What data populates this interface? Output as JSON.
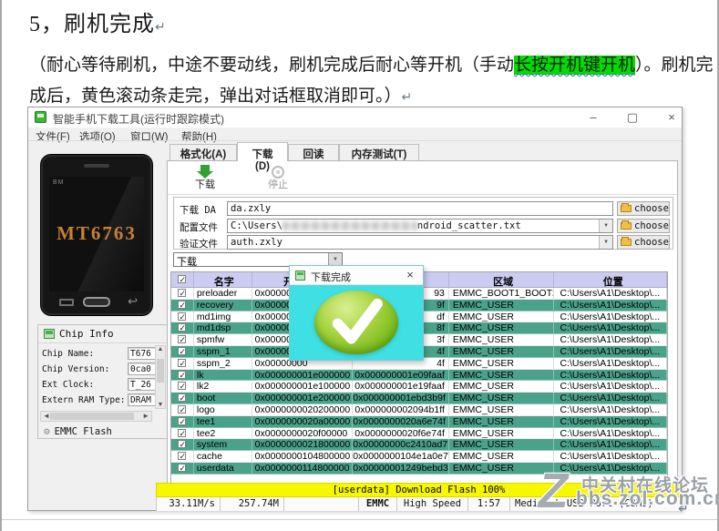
{
  "document": {
    "heading": "5，刷机完成",
    "line1_pre": "（耐心等待刷机，中途不要动线，刷机完成后耐心等开机（手动",
    "line1_highlight": "长按开机键开机",
    "line1_post": "）。刷机完",
    "line2": "成后，黄色滚动条走完，弹出对话框取消即可。）",
    "pilcrow": "↵"
  },
  "window": {
    "title": "智能手机下载工具(运行时跟踪模式)",
    "menu": [
      "文件(F)",
      "选项(O)",
      "窗口(W)",
      "帮助(H)"
    ],
    "controls": {
      "minimize": "–",
      "maximize": "▢",
      "close": "×"
    }
  },
  "tabs": [
    {
      "label": "格式化(A)",
      "active": false
    },
    {
      "label": "下载(D)",
      "active": true
    },
    {
      "label": "回读(R)",
      "active": false
    },
    {
      "label": "内存测试(T)",
      "active": false
    }
  ],
  "toolbar": {
    "download": "下载",
    "stop": "停止"
  },
  "form": {
    "da_label": "下载 DA",
    "da_value": "da.zxly",
    "scatter_label": "配置文件",
    "scatter_prefix": "C:\\Users\\",
    "scatter_suffix": "ndroid_scatter.txt",
    "auth_label": "验证文件",
    "auth_value": "auth.zxly",
    "choose_label": "choose",
    "mode": "下载"
  },
  "table": {
    "headers": {
      "name": "名字",
      "start": "开始地址",
      "end": "",
      "region": "区域",
      "location": "位置"
    },
    "rows": [
      {
        "name": "preloader",
        "start": "0x00000000",
        "end": "93",
        "region": "EMMC_BOOT1_BOOT2",
        "location": "C:\\Users\\A1\\Desktop\\..."
      },
      {
        "name": "recovery",
        "start": "0x00000000",
        "end": "9f",
        "region": "EMMC_USER",
        "location": "C:\\Users\\A1\\Desktop\\..."
      },
      {
        "name": "md1img",
        "start": "0x00000000",
        "end": "df",
        "region": "EMMC_USER",
        "location": "C:\\Users\\A1\\Desktop\\..."
      },
      {
        "name": "md1dsp",
        "start": "0x00000000",
        "end": "8f",
        "region": "EMMC_USER",
        "location": "C:\\Users\\A1\\Desktop\\..."
      },
      {
        "name": "spmfw",
        "start": "0x00000000",
        "end": "3f",
        "region": "EMMC_USER",
        "location": "C:\\Users\\A1\\Desktop\\..."
      },
      {
        "name": "sspm_1",
        "start": "0x00000000",
        "end": "4f",
        "region": "EMMC_USER",
        "location": "C:\\Users\\A1\\Desktop\\..."
      },
      {
        "name": "sspm_2",
        "start": "0x00000000",
        "end": "4f",
        "region": "EMMC_USER",
        "location": "C:\\Users\\A1\\Desktop\\..."
      },
      {
        "name": "lk",
        "start": "0x000000001e000000",
        "end": "0x000000001e09faaf",
        "region": "EMMC_USER",
        "location": "C:\\Users\\A1\\Desktop\\..."
      },
      {
        "name": "lk2",
        "start": "0x000000001e100000",
        "end": "0x000000001e19faaf",
        "region": "EMMC_USER",
        "location": "C:\\Users\\A1\\Desktop\\..."
      },
      {
        "name": "boot",
        "start": "0x000000001e200000",
        "end": "0x000000001ebd3b9f",
        "region": "EMMC_USER",
        "location": "C:\\Users\\A1\\Desktop\\..."
      },
      {
        "name": "logo",
        "start": "0x0000000020200000",
        "end": "0x000000002094b1ff",
        "region": "EMMC_USER",
        "location": "C:\\Users\\A1\\Desktop\\..."
      },
      {
        "name": "tee1",
        "start": "0x0000000020a00000",
        "end": "0x0000000020a6e74f",
        "region": "EMMC_USER",
        "location": "C:\\Users\\A1\\Desktop\\..."
      },
      {
        "name": "tee2",
        "start": "0x0000000020f00000",
        "end": "0x0000000020f6e74f",
        "region": "EMMC_USER",
        "location": "C:\\Users\\A1\\Desktop\\..."
      },
      {
        "name": "system",
        "start": "0x0000000021800000",
        "end": "0x00000000c2410ad7",
        "region": "EMMC_USER",
        "location": "C:\\Users\\A1\\Desktop\\..."
      },
      {
        "name": "cache",
        "start": "0x0000000104800000",
        "end": "0x0000000104e1a0e7",
        "region": "EMMC_USER",
        "location": "C:\\Users\\A1\\Desktop\\..."
      },
      {
        "name": "userdata",
        "start": "0x0000000114800000",
        "end": "0x00000001249bebd3",
        "region": "EMMC_USER",
        "location": "C:\\Users\\A1\\Desktop\\..."
      }
    ]
  },
  "dialog": {
    "title": "下载完成",
    "close": "×"
  },
  "progress": {
    "label": "[userdata] Download Flash 100%",
    "percent": 100
  },
  "status": {
    "speed": "33.11M/s",
    "written": "257.74M",
    "storage": "EMMC",
    "usb_mode": "High Speed",
    "elapsed": "1:57",
    "port": "MediaTek USB Port (COM9)"
  },
  "chip_info": {
    "title": "Chip Info",
    "fields": [
      {
        "label": "Chip Name:",
        "value": "T676"
      },
      {
        "label": "Chip Version:",
        "value": "0ca0"
      },
      {
        "label": "Ext Clock:",
        "value": "T_26"
      },
      {
        "label": "Extern RAM Type:",
        "value": "DRAM"
      }
    ],
    "flash_type": "EMMC Flash"
  },
  "phone": {
    "model": "MT6763",
    "screen_corner": "BM"
  },
  "watermark": {
    "logo": "Z",
    "line1": "中关村在线论坛",
    "line2": "bbs.zol.com.cn"
  },
  "icons": {
    "checkbox_check": "✓",
    "dropdown_arrow": "▼",
    "scroll_up": "▲",
    "scroll_down": "▼",
    "scroll_left": "◄",
    "scroll_right": "►",
    "gear": "⚙",
    "back_arrow": "↩"
  },
  "colors": {
    "row_green": "#4aa28a",
    "table_header": "#ccccf2",
    "progress_yellow": "#f7f700",
    "dialog_cyan": "#3fe0e4",
    "text_highlight": "#00dd00"
  }
}
